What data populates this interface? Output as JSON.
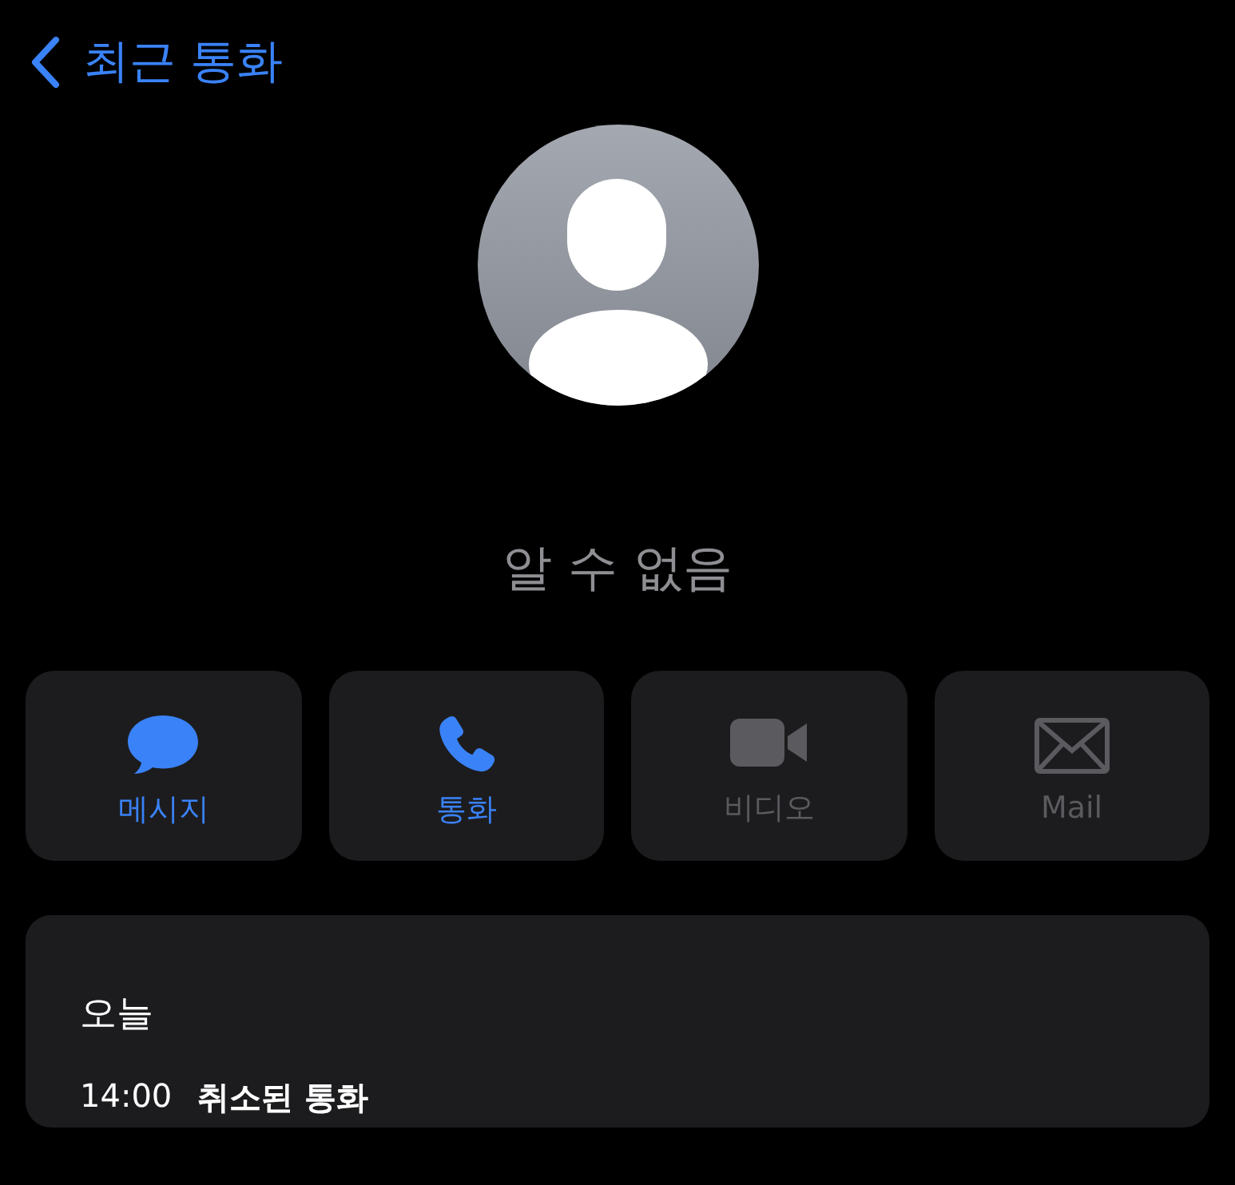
{
  "back": {
    "label": "최근 통화"
  },
  "contact": {
    "name": "알 수 없음"
  },
  "actions": [
    {
      "kind": "message",
      "label": "메시지",
      "disabled": false
    },
    {
      "kind": "call",
      "label": "통화",
      "disabled": false
    },
    {
      "kind": "video",
      "label": "비디오",
      "disabled": true
    },
    {
      "kind": "mail",
      "label": "Mail",
      "disabled": true
    }
  ],
  "history": {
    "heading": "오늘",
    "entries": [
      {
        "time": "14:00",
        "status": "취소된 통화"
      }
    ]
  }
}
